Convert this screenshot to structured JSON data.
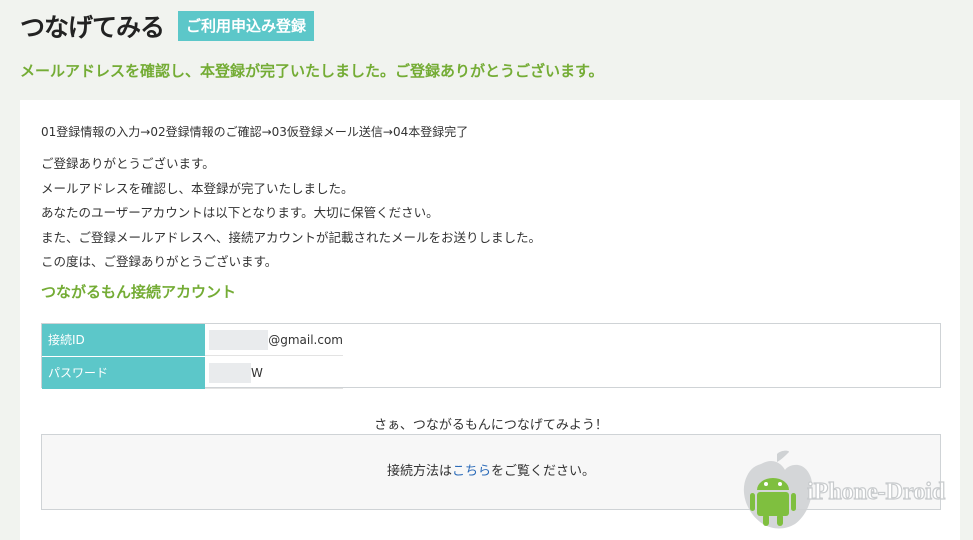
{
  "header": {
    "logo": "つなげてみる",
    "badge": "ご利用申込み登録"
  },
  "headline": "メールアドレスを確認し、本登録が完了いたしました。ご登録ありがとうございます。",
  "steps": "01登録情報の入力→02登録情報のご確認→03仮登録メール送信→04本登録完了",
  "message_lines": [
    "ご登録ありがとうございます。",
    "メールアドレスを確認し、本登録が完了いたしました。",
    "あなたのユーザーアカウントは以下となります。大切に保管ください。",
    "また、ご登録メールアドレスへ、接続アカウントが記載されたメールをお送りしました。",
    "この度は、ご登録ありがとうございます。"
  ],
  "section_title": "つながるもん接続アカウント",
  "account": {
    "id_label": "接続ID",
    "id_value_suffix": "@gmail.com",
    "password_label": "パスワード",
    "password_value_suffix": "W"
  },
  "cta": "さぁ、つながるもんにつなげてみよう！",
  "method": {
    "before": "接続方法は",
    "link": "こちら",
    "after": "をご覧ください。"
  },
  "watermark": "iPhone-Droid"
}
